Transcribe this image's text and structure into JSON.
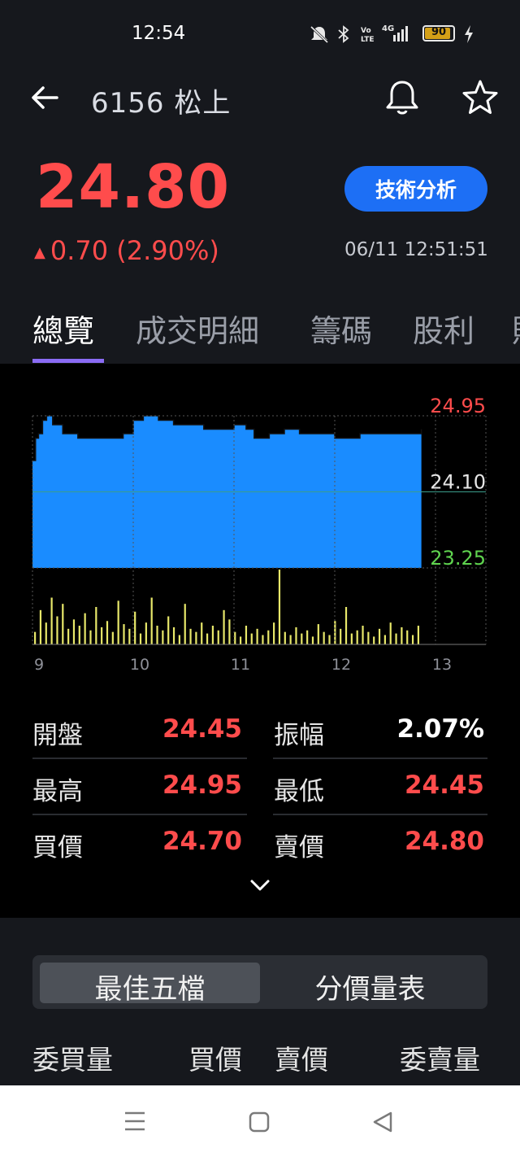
{
  "status": {
    "time": "12:54",
    "icons": [
      "mute-icon",
      "bluetooth-icon",
      "volte-icon",
      "4g-signal-icon"
    ],
    "battery_level": 90,
    "battery_text": "90"
  },
  "header": {
    "title": "6156 松上",
    "price": "24.80",
    "change": "0.70 (2.90%)",
    "change_direction": "up",
    "timestamp": "06/11 12:51:51",
    "tech_button": "技術分析"
  },
  "tabs": [
    {
      "label": "總覽",
      "active": true
    },
    {
      "label": "成交明細",
      "active": false
    },
    {
      "label": "籌碼",
      "active": false
    },
    {
      "label": "股利",
      "active": false
    },
    {
      "label": "財",
      "active": false
    }
  ],
  "colors": {
    "up": "#ff4c4c",
    "down": "#5fd44f",
    "area": "#1a8cff",
    "volume": "#e8e86a",
    "accent": "#1d6ff5",
    "tab_indicator": "#8b6cf5"
  },
  "chart_data": {
    "type": "area",
    "x_ticks": [
      "9",
      "10",
      "11",
      "12",
      "13"
    ],
    "y_ticks": [
      {
        "label": "24.95",
        "value": 24.95,
        "color": "up"
      },
      {
        "label": "24.10",
        "value": 24.1,
        "color": "neutral"
      },
      {
        "label": "23.25",
        "value": 23.25,
        "color": "down"
      }
    ],
    "ylim": [
      23.25,
      24.95
    ],
    "reference_price": 24.1,
    "session_hours": [
      9,
      13.5
    ],
    "price_series": [
      {
        "t": 9.0,
        "v": 24.45
      },
      {
        "t": 9.03,
        "v": 24.7
      },
      {
        "t": 9.06,
        "v": 24.75
      },
      {
        "t": 9.1,
        "v": 24.9
      },
      {
        "t": 9.14,
        "v": 24.95
      },
      {
        "t": 9.2,
        "v": 24.85
      },
      {
        "t": 9.3,
        "v": 24.75
      },
      {
        "t": 9.45,
        "v": 24.7
      },
      {
        "t": 9.6,
        "v": 24.7
      },
      {
        "t": 9.75,
        "v": 24.7
      },
      {
        "t": 9.9,
        "v": 24.75
      },
      {
        "t": 10.0,
        "v": 24.9
      },
      {
        "t": 10.1,
        "v": 24.95
      },
      {
        "t": 10.25,
        "v": 24.9
      },
      {
        "t": 10.4,
        "v": 24.85
      },
      {
        "t": 10.55,
        "v": 24.85
      },
      {
        "t": 10.7,
        "v": 24.8
      },
      {
        "t": 10.85,
        "v": 24.8
      },
      {
        "t": 11.0,
        "v": 24.85
      },
      {
        "t": 11.12,
        "v": 24.8
      },
      {
        "t": 11.2,
        "v": 24.7
      },
      {
        "t": 11.35,
        "v": 24.75
      },
      {
        "t": 11.5,
        "v": 24.8
      },
      {
        "t": 11.65,
        "v": 24.75
      },
      {
        "t": 11.8,
        "v": 24.75
      },
      {
        "t": 12.0,
        "v": 24.7
      },
      {
        "t": 12.15,
        "v": 24.7
      },
      {
        "t": 12.25,
        "v": 24.75
      },
      {
        "t": 12.4,
        "v": 24.75
      },
      {
        "t": 12.55,
        "v": 24.75
      },
      {
        "t": 12.7,
        "v": 24.75
      },
      {
        "t": 12.82,
        "v": 24.75
      },
      {
        "t": 12.86,
        "v": 24.8
      }
    ],
    "volume_series": [
      8,
      22,
      14,
      30,
      18,
      26,
      10,
      16,
      12,
      20,
      9,
      24,
      11,
      15,
      8,
      28,
      13,
      10,
      21,
      7,
      14,
      30,
      12,
      9,
      18,
      11,
      6,
      26,
      10,
      8,
      14,
      7,
      12,
      9,
      22,
      16,
      8,
      5,
      12,
      7,
      10,
      6,
      9,
      14,
      48,
      8,
      6,
      11,
      7,
      9,
      5,
      13,
      8,
      6,
      15,
      10,
      24,
      7,
      9,
      12,
      8,
      5,
      10,
      6,
      14,
      7,
      11,
      9,
      6,
      12
    ]
  },
  "stats": [
    {
      "label": "開盤",
      "value": "24.45",
      "color": "up",
      "label2": "振幅",
      "value2": "2.07%",
      "color2": "neutral"
    },
    {
      "label": "最高",
      "value": "24.95",
      "color": "up",
      "label2": "最低",
      "value2": "24.45",
      "color2": "up"
    },
    {
      "label": "買價",
      "value": "24.70",
      "color": "up",
      "label2": "賣價",
      "value2": "24.80",
      "color2": "up"
    }
  ],
  "order_book": {
    "segments": [
      "最佳五檔",
      "分價量表"
    ],
    "active_segment": 0,
    "columns": [
      "委買量",
      "買價",
      "賣價",
      "委賣量"
    ]
  }
}
